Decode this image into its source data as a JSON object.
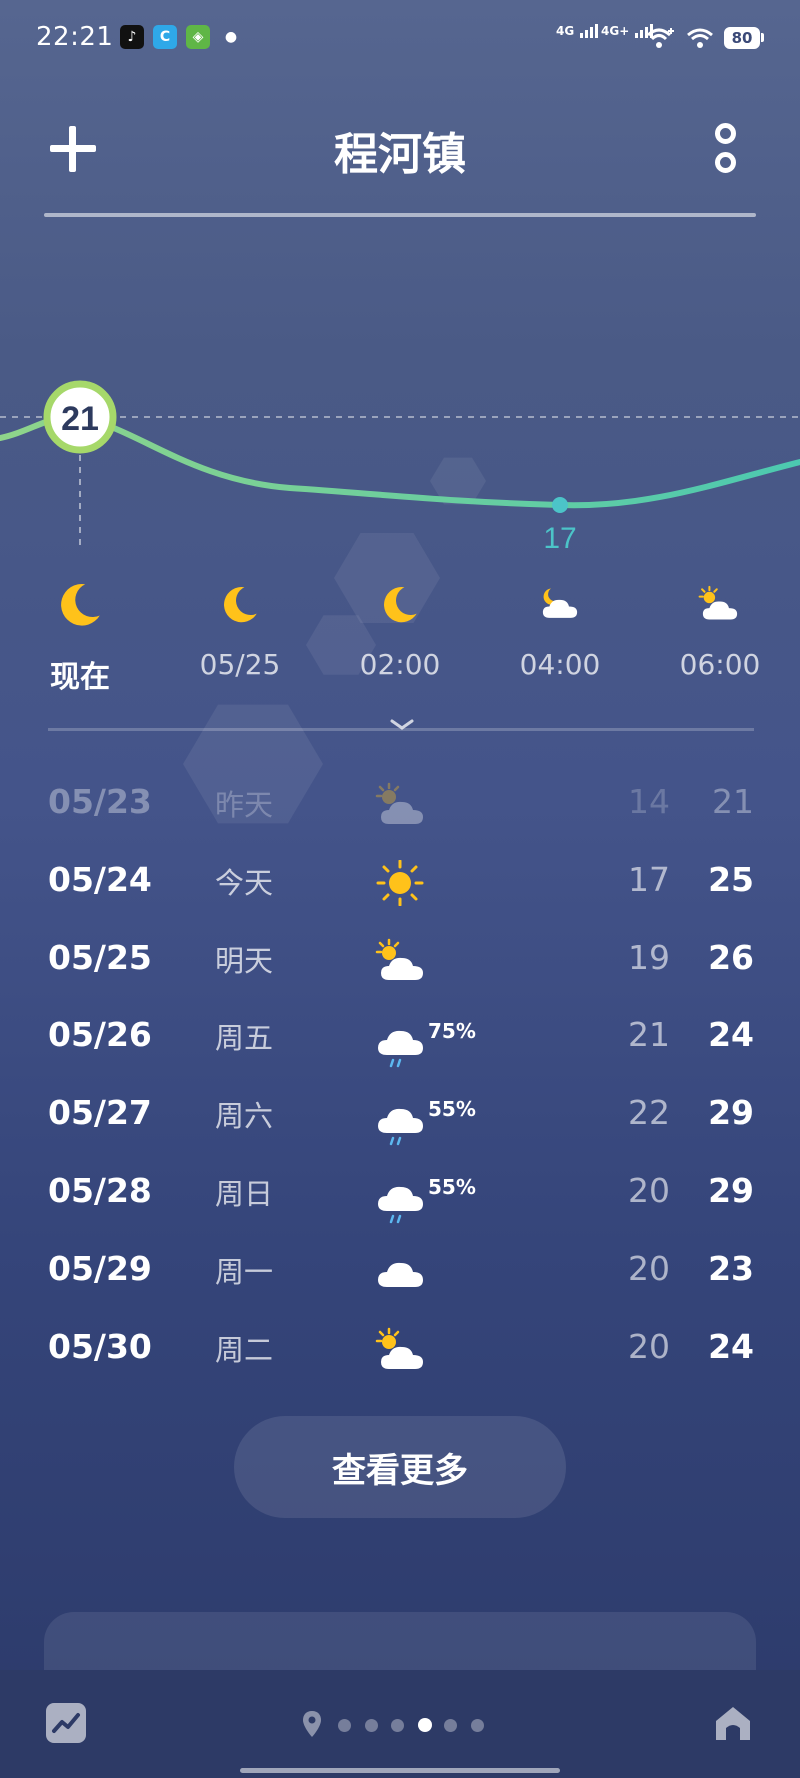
{
  "status_bar": {
    "time": "22:21",
    "apps": [
      {
        "name": "tiktok-icon",
        "glyph": "♪",
        "bg": "#111111",
        "fg": "#ffffff"
      },
      {
        "name": "browser-icon",
        "glyph": "C",
        "bg": "#2fa8e8",
        "fg": "#ffffff"
      },
      {
        "name": "maps-app-icon",
        "glyph": "◈",
        "bg": "#5fb646",
        "fg": "#ffffff"
      },
      {
        "name": "wechat-icon",
        "glyph": "●",
        "bg": "transparent",
        "fg": "#ffffff"
      }
    ],
    "sim1": "4G",
    "sim2": "4G+",
    "battery": "80"
  },
  "header": {
    "city": "程河镇"
  },
  "hourly": {
    "current_temp": "21",
    "min_temp": "17",
    "items": [
      {
        "label": "现在",
        "icon": "moon-icon",
        "now": true
      },
      {
        "label": "05/25",
        "icon": "moon-icon",
        "now": false
      },
      {
        "label": "02:00",
        "icon": "moon-icon",
        "now": false
      },
      {
        "label": "04:00",
        "icon": "moon-cloud-icon",
        "now": false
      },
      {
        "label": "06:00",
        "icon": "sun-cloud-icon",
        "now": false
      }
    ]
  },
  "daily": [
    {
      "date": "05/23",
      "week": "昨天",
      "icon": "sun-cloud-icon",
      "precip": "",
      "low": "14",
      "high": "21",
      "past": true
    },
    {
      "date": "05/24",
      "week": "今天",
      "icon": "sun-icon",
      "precip": "",
      "low": "17",
      "high": "25",
      "past": false
    },
    {
      "date": "05/25",
      "week": "明天",
      "icon": "sun-cloud-icon",
      "precip": "",
      "low": "19",
      "high": "26",
      "past": false
    },
    {
      "date": "05/26",
      "week": "周五",
      "icon": "rain-icon",
      "precip": "75%",
      "low": "21",
      "high": "24",
      "past": false
    },
    {
      "date": "05/27",
      "week": "周六",
      "icon": "rain-icon",
      "precip": "55%",
      "low": "22",
      "high": "29",
      "past": false
    },
    {
      "date": "05/28",
      "week": "周日",
      "icon": "rain-icon",
      "precip": "55%",
      "low": "20",
      "high": "29",
      "past": false
    },
    {
      "date": "05/29",
      "week": "周一",
      "icon": "cloud-icon",
      "precip": "",
      "low": "20",
      "high": "23",
      "past": false
    },
    {
      "date": "05/30",
      "week": "周二",
      "icon": "sun-cloud-icon",
      "precip": "",
      "low": "20",
      "high": "24",
      "past": false
    }
  ],
  "see_more": "查看更多",
  "colors": {
    "curve_start": "#8fd48a",
    "curve_end": "#4cc9b0",
    "current_ring": "#a6d86a",
    "min_label": "#4cc4c8",
    "sun": "#ffc21a"
  },
  "nav": {
    "page_count": 6,
    "active_page": 3
  }
}
